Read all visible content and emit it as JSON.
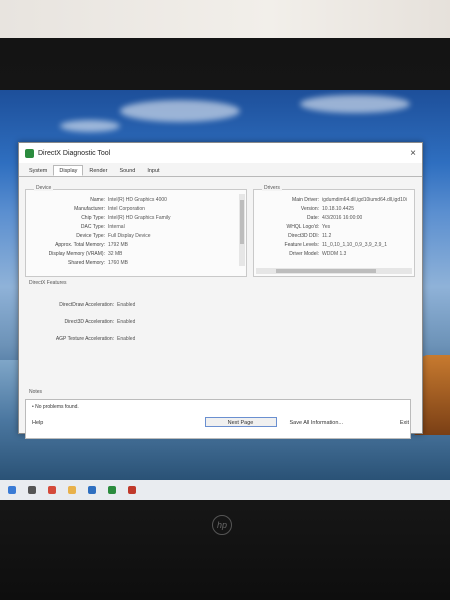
{
  "window": {
    "title": "DirectX Diagnostic Tool"
  },
  "tabs": [
    {
      "label": "System"
    },
    {
      "label": "Display"
    },
    {
      "label": "Render"
    },
    {
      "label": "Sound"
    },
    {
      "label": "Input"
    }
  ],
  "device": {
    "section_label": "Device",
    "rows": [
      {
        "k": "Name:",
        "v": "Intel(R) HD Graphics 4000"
      },
      {
        "k": "Manufacturer:",
        "v": "Intel Corporation"
      },
      {
        "k": "Chip Type:",
        "v": "Intel(R) HD Graphics Family"
      },
      {
        "k": "DAC Type:",
        "v": "Internal"
      },
      {
        "k": "Device Type:",
        "v": "Full Display Device"
      },
      {
        "k": "Approx. Total Memory:",
        "v": "1792 MB"
      },
      {
        "k": "Display Memory (VRAM):",
        "v": "32 MB"
      },
      {
        "k": "Shared Memory:",
        "v": "1760 MB"
      }
    ]
  },
  "drivers": {
    "section_label": "Drivers",
    "rows": [
      {
        "k": "Main Driver:",
        "v": "igdumdim64.dll,igd10iumd64.dll,igd10i"
      },
      {
        "k": "Version:",
        "v": "10.18.10.4425"
      },
      {
        "k": "Date:",
        "v": "4/3/2016 16:00:00"
      },
      {
        "k": "WHQL Logo'd:",
        "v": "Yes"
      },
      {
        "k": "Direct3D DDI:",
        "v": "11.2"
      },
      {
        "k": "Feature Levels:",
        "v": "11_0,10_1,10_0,9_3,9_2,9_1"
      },
      {
        "k": "Driver Model:",
        "v": "WDDM 1.3"
      }
    ]
  },
  "directx_features": {
    "section_label": "DirectX Features",
    "rows": [
      {
        "k": "DirectDraw Acceleration:",
        "v": "Enabled"
      },
      {
        "k": "Direct3D Acceleration:",
        "v": "Enabled"
      },
      {
        "k": "AGP Texture Acceleration:",
        "v": "Enabled"
      }
    ]
  },
  "notes": {
    "section_label": "Notes",
    "items": [
      "No problems found."
    ]
  },
  "buttons": {
    "help": "Help",
    "next_page": "Next Page",
    "save_all": "Save All Information...",
    "exit": "Exit"
  },
  "colors": {
    "title_icon": "#2b8c3e",
    "focus_border": "#6a8fd0"
  }
}
